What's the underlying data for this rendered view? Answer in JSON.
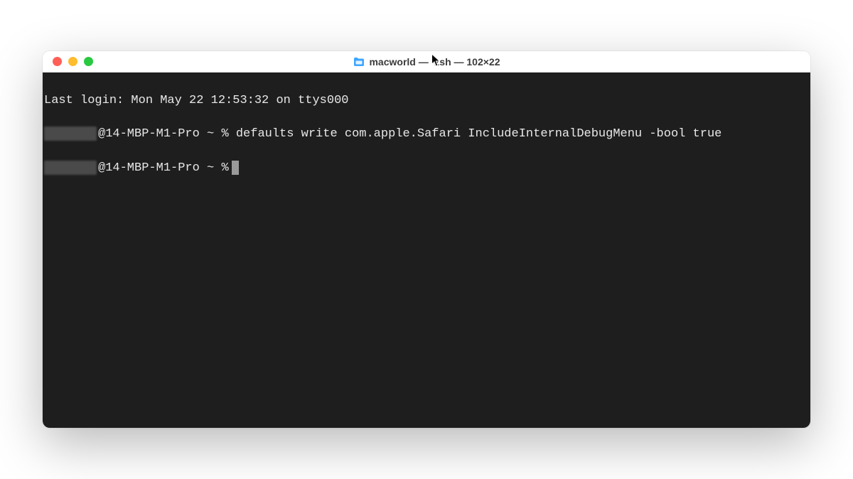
{
  "window": {
    "title": "macworld — -zsh — 102×22"
  },
  "terminal": {
    "last_login": "Last login: Mon May 22 12:53:32 on ttys000",
    "prompt_host": "@14-MBP-M1-Pro",
    "prompt_path": "~",
    "prompt_symbol": "%",
    "command": "defaults write com.apple.Safari IncludeInternalDebugMenu -bool true"
  },
  "colors": {
    "bg": "#1e1e1e",
    "fg": "#e8e8e8",
    "close": "#ff5f57",
    "minimize": "#febc2e",
    "maximize": "#28c840"
  }
}
